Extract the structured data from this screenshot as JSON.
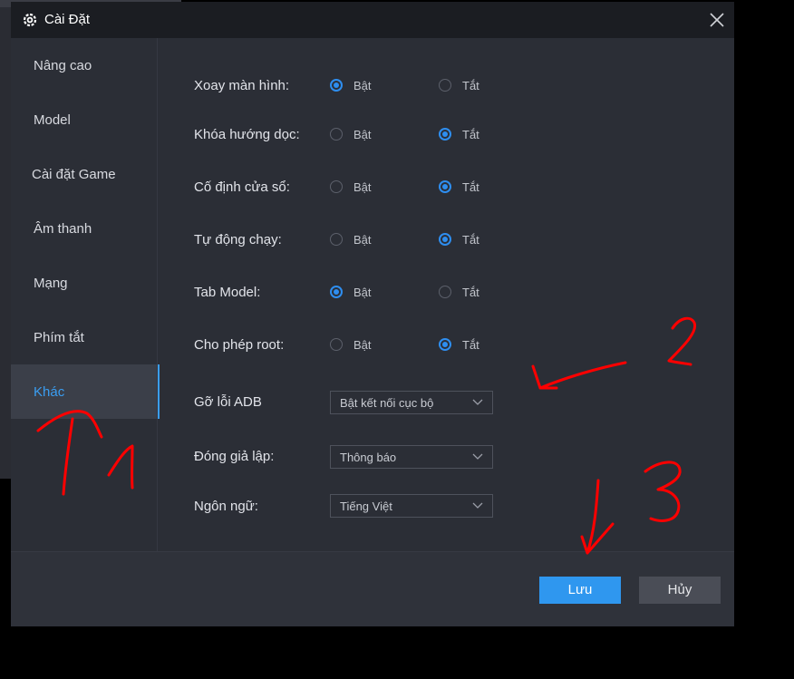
{
  "window": {
    "title": "Cài Đặt"
  },
  "sidebar": {
    "items": [
      {
        "label": "Nâng cao"
      },
      {
        "label": "Model"
      },
      {
        "label": "Cài đặt Game"
      },
      {
        "label": "Âm thanh"
      },
      {
        "label": "Mạng"
      },
      {
        "label": "Phím tắt"
      },
      {
        "label": "Khác",
        "active": true
      }
    ]
  },
  "settings": {
    "on_label": "Bật",
    "off_label": "Tắt",
    "radio_rows": [
      {
        "label": "Xoay màn hình:",
        "selected": "on"
      },
      {
        "label": "Khóa hướng dọc:",
        "selected": "off"
      },
      {
        "label": "Cố định cửa sổ:",
        "selected": "off"
      },
      {
        "label": "Tự động chạy:",
        "selected": "off"
      },
      {
        "label": "Tab Model:",
        "selected": "on"
      },
      {
        "label": "Cho phép root:",
        "selected": "off"
      }
    ],
    "selects": [
      {
        "label": "Gỡ lỗi ADB",
        "value": "Bật kết nối cục bộ"
      },
      {
        "label": "Đóng giả lập:",
        "value": "Thông báo"
      },
      {
        "label": "Ngôn ngữ:",
        "value": "Tiếng Việt"
      }
    ]
  },
  "footer": {
    "save_label": "Lưu",
    "cancel_label": "Hủy"
  },
  "colors": {
    "accent": "#2e8ef0",
    "annotation": "#ff0000"
  },
  "annotations": [
    {
      "number": "1",
      "target": "sidebar-item-khac"
    },
    {
      "number": "2",
      "target": "select-adb"
    },
    {
      "number": "3",
      "target": "save-button"
    }
  ]
}
